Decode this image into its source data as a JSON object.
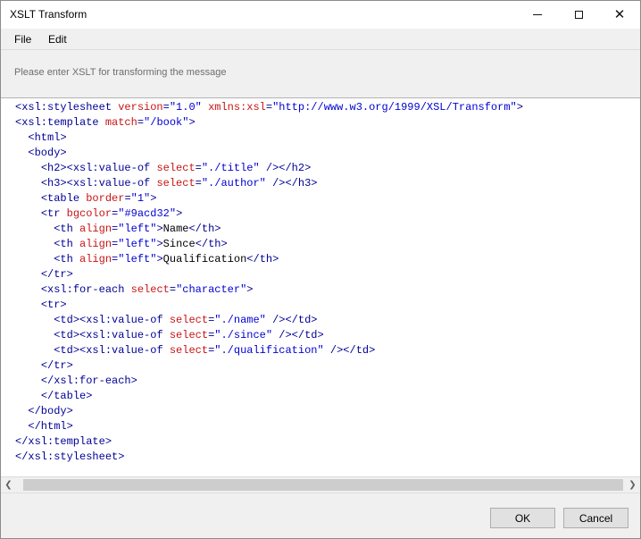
{
  "window": {
    "title": "XSLT Transform"
  },
  "menu": {
    "file": "File",
    "edit": "Edit"
  },
  "prompt": "Please enter XSLT for transforming the message",
  "editor": {
    "lines": [
      [
        [
          "tag",
          "<xsl:stylesheet "
        ],
        [
          "attr",
          "version"
        ],
        [
          "tag",
          "="
        ],
        [
          "val",
          "\"1.0\""
        ],
        [
          "tag",
          " "
        ],
        [
          "attr",
          "xmlns:xsl"
        ],
        [
          "tag",
          "="
        ],
        [
          "val",
          "\"http://www.w3.org/1999/XSL/Transform\""
        ],
        [
          "tag",
          ">"
        ]
      ],
      [
        [
          "tag",
          "<xsl:template "
        ],
        [
          "attr",
          "match"
        ],
        [
          "tag",
          "="
        ],
        [
          "val",
          "\"/book\""
        ],
        [
          "tag",
          ">"
        ]
      ],
      [
        [
          "txt",
          "  "
        ],
        [
          "tag",
          "<html>"
        ]
      ],
      [
        [
          "txt",
          "  "
        ],
        [
          "tag",
          "<body>"
        ]
      ],
      [
        [
          "txt",
          "    "
        ],
        [
          "tag",
          "<h2><xsl:value-of "
        ],
        [
          "attr",
          "select"
        ],
        [
          "tag",
          "="
        ],
        [
          "val",
          "\"./title\""
        ],
        [
          "tag",
          " /></h2>"
        ]
      ],
      [
        [
          "txt",
          "    "
        ],
        [
          "tag",
          "<h3><xsl:value-of "
        ],
        [
          "attr",
          "select"
        ],
        [
          "tag",
          "="
        ],
        [
          "val",
          "\"./author\""
        ],
        [
          "tag",
          " /></h3>"
        ]
      ],
      [
        [
          "txt",
          "    "
        ],
        [
          "tag",
          "<table "
        ],
        [
          "attr",
          "border"
        ],
        [
          "tag",
          "="
        ],
        [
          "val",
          "\"1\""
        ],
        [
          "tag",
          ">"
        ]
      ],
      [
        [
          "txt",
          "    "
        ],
        [
          "tag",
          "<tr "
        ],
        [
          "attr",
          "bgcolor"
        ],
        [
          "tag",
          "="
        ],
        [
          "val",
          "\"#9acd32\""
        ],
        [
          "tag",
          ">"
        ]
      ],
      [
        [
          "txt",
          "      "
        ],
        [
          "tag",
          "<th "
        ],
        [
          "attr",
          "align"
        ],
        [
          "tag",
          "="
        ],
        [
          "val",
          "\"left\""
        ],
        [
          "tag",
          ">"
        ],
        [
          "txt",
          "Name"
        ],
        [
          "tag",
          "</th>"
        ]
      ],
      [
        [
          "txt",
          "      "
        ],
        [
          "tag",
          "<th "
        ],
        [
          "attr",
          "align"
        ],
        [
          "tag",
          "="
        ],
        [
          "val",
          "\"left\""
        ],
        [
          "tag",
          ">"
        ],
        [
          "txt",
          "Since"
        ],
        [
          "tag",
          "</th>"
        ]
      ],
      [
        [
          "txt",
          "      "
        ],
        [
          "tag",
          "<th "
        ],
        [
          "attr",
          "align"
        ],
        [
          "tag",
          "="
        ],
        [
          "val",
          "\"left\""
        ],
        [
          "tag",
          ">"
        ],
        [
          "txt",
          "Qualification"
        ],
        [
          "tag",
          "</th>"
        ]
      ],
      [
        [
          "txt",
          "    "
        ],
        [
          "tag",
          "</tr>"
        ]
      ],
      [
        [
          "txt",
          "    "
        ],
        [
          "tag",
          "<xsl:for-each "
        ],
        [
          "attr",
          "select"
        ],
        [
          "tag",
          "="
        ],
        [
          "val",
          "\"character\""
        ],
        [
          "tag",
          ">"
        ]
      ],
      [
        [
          "txt",
          "    "
        ],
        [
          "tag",
          "<tr>"
        ]
      ],
      [
        [
          "txt",
          "      "
        ],
        [
          "tag",
          "<td><xsl:value-of "
        ],
        [
          "attr",
          "select"
        ],
        [
          "tag",
          "="
        ],
        [
          "val",
          "\"./name\""
        ],
        [
          "tag",
          " /></td>"
        ]
      ],
      [
        [
          "txt",
          "      "
        ],
        [
          "tag",
          "<td><xsl:value-of "
        ],
        [
          "attr",
          "select"
        ],
        [
          "tag",
          "="
        ],
        [
          "val",
          "\"./since\""
        ],
        [
          "tag",
          " /></td>"
        ]
      ],
      [
        [
          "txt",
          "      "
        ],
        [
          "tag",
          "<td><xsl:value-of "
        ],
        [
          "attr",
          "select"
        ],
        [
          "tag",
          "="
        ],
        [
          "val",
          "\"./qualification\""
        ],
        [
          "tag",
          " /></td>"
        ]
      ],
      [
        [
          "txt",
          "    "
        ],
        [
          "tag",
          "</tr>"
        ]
      ],
      [
        [
          "txt",
          "    "
        ],
        [
          "tag",
          "</xsl:for-each>"
        ]
      ],
      [
        [
          "txt",
          "    "
        ],
        [
          "tag",
          "</table>"
        ]
      ],
      [
        [
          "txt",
          "  "
        ],
        [
          "tag",
          "</body>"
        ]
      ],
      [
        [
          "txt",
          "  "
        ],
        [
          "tag",
          "</html>"
        ]
      ],
      [
        [
          "tag",
          "</xsl:template>"
        ]
      ],
      [
        [
          "tag",
          "</xsl:stylesheet>"
        ]
      ]
    ]
  },
  "buttons": {
    "ok": "OK",
    "cancel": "Cancel"
  },
  "icons": {
    "minimize": "minimize-icon",
    "maximize": "maximize-icon",
    "close": "close-icon",
    "scroll_left": "chevron-left-icon",
    "scroll_right": "chevron-right-icon"
  }
}
